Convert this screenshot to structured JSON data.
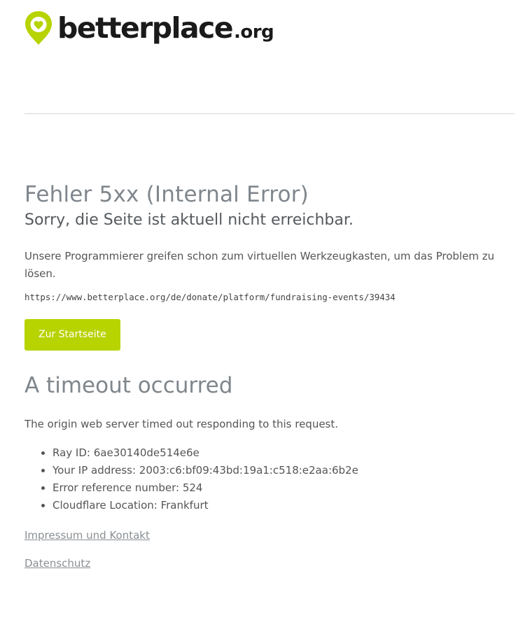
{
  "brand": {
    "name": "betterplace",
    "tld": ".org",
    "accent_color": "#b7d300"
  },
  "error": {
    "title": "Fehler 5xx (Internal Error)",
    "subtitle": "Sorry, die Seite ist aktuell nicht erreichbar.",
    "description": "Unsere Programmierer greifen schon zum virtuellen Werkzeugkasten, um das Problem zu lösen.",
    "url": "https://www.betterplace.org/de/donate/platform/fundraising-events/39434",
    "button_label": "Zur Startseite"
  },
  "cloudflare": {
    "title": "A timeout occurred",
    "description": "The origin web server timed out responding to this request.",
    "details": [
      "Ray ID: 6ae30140de514e6e",
      "Your IP address: 2003:c6:bf09:43bd:19a1:c518:e2aa:6b2e",
      "Error reference number: 524",
      "Cloudflare Location: Frankfurt"
    ]
  },
  "footer": {
    "impressum_label": "Impressum und Kontakt",
    "datenschutz_label": "Datenschutz"
  }
}
